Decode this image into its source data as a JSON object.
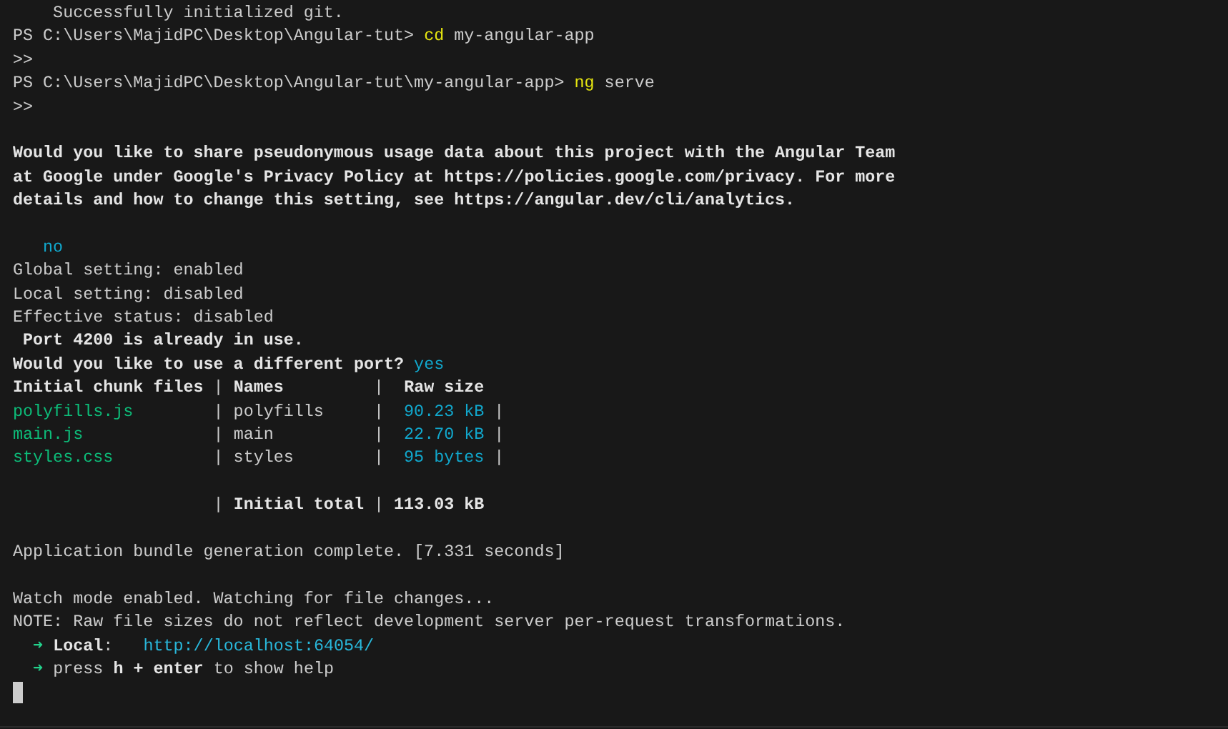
{
  "terminal": {
    "lines": [
      {
        "kind": "text",
        "segments": [
          {
            "text": "    Successfully initialized git.",
            "kind": "plain"
          }
        ]
      },
      {
        "kind": "text",
        "segments": [
          {
            "text": "PS C:\\Users\\MajidPC\\Desktop\\Angular-tut> ",
            "kind": "plain"
          },
          {
            "text": "cd",
            "kind": "command"
          },
          {
            "text": " my-angular-app",
            "kind": "plain"
          }
        ]
      },
      {
        "kind": "text",
        "segments": [
          {
            "text": ">>",
            "kind": "plain"
          }
        ]
      },
      {
        "kind": "text",
        "segments": [
          {
            "text": "PS C:\\Users\\MajidPC\\Desktop\\Angular-tut\\my-angular-app> ",
            "kind": "plain"
          },
          {
            "text": "ng",
            "kind": "command"
          },
          {
            "text": " serve",
            "kind": "plain"
          }
        ]
      },
      {
        "kind": "text",
        "segments": [
          {
            "text": ">>",
            "kind": "plain"
          }
        ]
      },
      {
        "kind": "blank"
      },
      {
        "kind": "text",
        "segments": [
          {
            "text": "Would you like to share pseudonymous usage data about this project with the Angular Team",
            "kind": "bold"
          }
        ]
      },
      {
        "kind": "text",
        "segments": [
          {
            "text": "at Google under Google's Privacy Policy at https://policies.google.com/privacy. For more",
            "kind": "bold"
          }
        ]
      },
      {
        "kind": "text",
        "segments": [
          {
            "text": "details and how to change this setting, see https://angular.dev/cli/analytics.",
            "kind": "bold"
          }
        ]
      },
      {
        "kind": "blank"
      },
      {
        "kind": "text",
        "segments": [
          {
            "text": "   no",
            "kind": "answer"
          }
        ]
      },
      {
        "kind": "text",
        "segments": [
          {
            "text": "Global setting: enabled",
            "kind": "plain"
          }
        ]
      },
      {
        "kind": "text",
        "segments": [
          {
            "text": "Local setting: disabled",
            "kind": "plain"
          }
        ]
      },
      {
        "kind": "text",
        "segments": [
          {
            "text": "Effective status: disabled",
            "kind": "plain"
          }
        ]
      },
      {
        "kind": "text",
        "segments": [
          {
            "text": " Port 4200 is already in use.",
            "kind": "bold"
          }
        ]
      },
      {
        "kind": "text",
        "segments": [
          {
            "text": "Would you like to use a different port?",
            "kind": "bold"
          },
          {
            "text": " yes",
            "kind": "answer"
          }
        ]
      },
      {
        "kind": "text",
        "segments": [
          {
            "text": "Initial chunk files",
            "kind": "bold"
          },
          {
            "text": " | ",
            "kind": "plain"
          },
          {
            "text": "Names",
            "kind": "bold"
          },
          {
            "text": "         |  ",
            "kind": "plain"
          },
          {
            "text": "Raw size",
            "kind": "bold"
          }
        ]
      },
      {
        "kind": "text",
        "segments": [
          {
            "text": "polyfills.js",
            "kind": "file"
          },
          {
            "text": "        | polyfills     |  ",
            "kind": "plain"
          },
          {
            "text": "90.23 kB",
            "kind": "answer"
          },
          {
            "text": " |",
            "kind": "plain"
          }
        ]
      },
      {
        "kind": "text",
        "segments": [
          {
            "text": "main.js",
            "kind": "file"
          },
          {
            "text": "             | main          |  ",
            "kind": "plain"
          },
          {
            "text": "22.70 kB",
            "kind": "answer"
          },
          {
            "text": " |",
            "kind": "plain"
          }
        ]
      },
      {
        "kind": "text",
        "segments": [
          {
            "text": "styles.css",
            "kind": "file"
          },
          {
            "text": "          | styles        |  ",
            "kind": "plain"
          },
          {
            "text": "95 bytes",
            "kind": "answer"
          },
          {
            "text": " |",
            "kind": "plain"
          }
        ]
      },
      {
        "kind": "blank"
      },
      {
        "kind": "text",
        "segments": [
          {
            "text": "                    | ",
            "kind": "plain"
          },
          {
            "text": "Initial total",
            "kind": "bold"
          },
          {
            "text": " | ",
            "kind": "plain"
          },
          {
            "text": "113.03 kB",
            "kind": "bold"
          }
        ]
      },
      {
        "kind": "blank"
      },
      {
        "kind": "text",
        "segments": [
          {
            "text": "Application bundle generation complete. [7.331 seconds]",
            "kind": "plain"
          }
        ]
      },
      {
        "kind": "blank"
      },
      {
        "kind": "text",
        "segments": [
          {
            "text": "Watch mode enabled. Watching for file changes...",
            "kind": "plain"
          }
        ]
      },
      {
        "kind": "text",
        "segments": [
          {
            "text": "NOTE: Raw file sizes do not reflect development server per-request transformations.",
            "kind": "plain"
          }
        ]
      },
      {
        "kind": "text",
        "segments": [
          {
            "text": "  ➜",
            "kind": "arrow"
          },
          {
            "text": " Local",
            "kind": "bold"
          },
          {
            "text": ":   ",
            "kind": "plain"
          },
          {
            "text": "http://localhost:64054/",
            "kind": "link"
          }
        ]
      },
      {
        "kind": "text",
        "segments": [
          {
            "text": "  ➜",
            "kind": "arrow"
          },
          {
            "text": " press ",
            "kind": "plain"
          },
          {
            "text": "h + enter",
            "kind": "bold"
          },
          {
            "text": " to show help",
            "kind": "plain"
          }
        ]
      },
      {
        "kind": "cursor"
      }
    ]
  }
}
